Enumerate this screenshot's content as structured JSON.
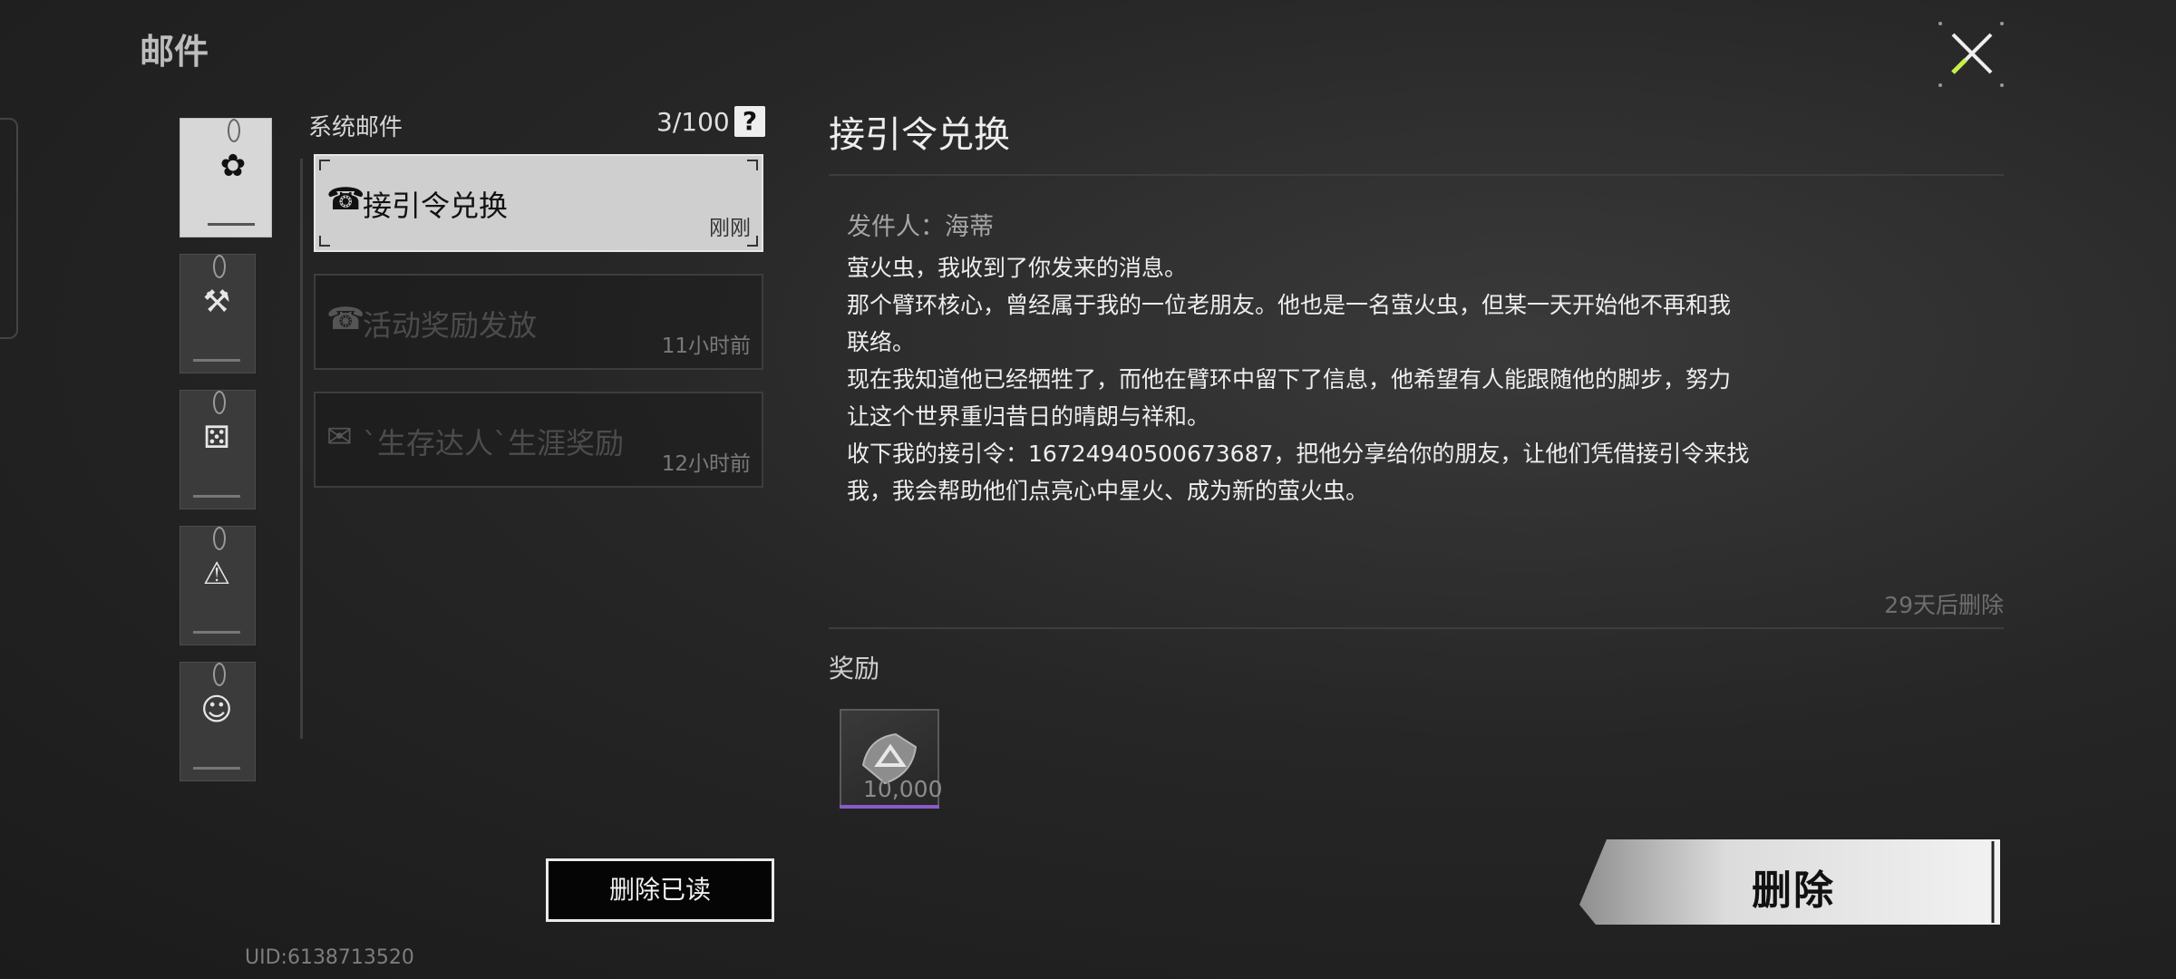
{
  "page": {
    "title": "邮件"
  },
  "list": {
    "header": "系统邮件",
    "count": "3/100",
    "help_icon": "question-icon",
    "items": [
      {
        "title": "接引令兑换",
        "time": "刚刚",
        "icon": "phone-icon"
      },
      {
        "title": "活动奖励发放",
        "time": "11小时前",
        "icon": "phone-icon"
      },
      {
        "title": "`生存达人`生涯奖励",
        "time": "12小时前",
        "icon": "envelope-icon"
      }
    ]
  },
  "categories": [
    "flower-icon",
    "hammer-icon",
    "dice-icon",
    "warning-icon",
    "avatar-icon"
  ],
  "actions": {
    "delete_read": "删除已读",
    "delete": "删除"
  },
  "uid": "UID:6138713520",
  "detail": {
    "subject": "接引令兑换",
    "sender": "发件人：海蒂",
    "body_lines": [
      "萤火虫，我收到了你发来的消息。",
      "那个臂环核心，曾经属于我的一位老朋友。他也是一名萤火虫，但某一天开始他不再和我",
      "联络。",
      "现在我知道他已经牺牲了，而他在臂环中留下了信息，他希望有人能跟随他的脚步，努力",
      "让这个世界重归昔日的晴朗与祥和。",
      "收下我的接引令：16724940500673687，把他分享给你的朋友，让他们凭借接引令来找",
      "我，我会帮助他们点亮心中星火、成为新的萤火虫。"
    ],
    "expire": "29天后删除",
    "reward_label": "奖励",
    "reward": {
      "quantity": "10,000",
      "icon": "armband-icon"
    }
  },
  "colors": {
    "active_item": "#cfcfcf",
    "reward_rarity": "#8a5ac8",
    "accent_close": "#c8f04a"
  }
}
